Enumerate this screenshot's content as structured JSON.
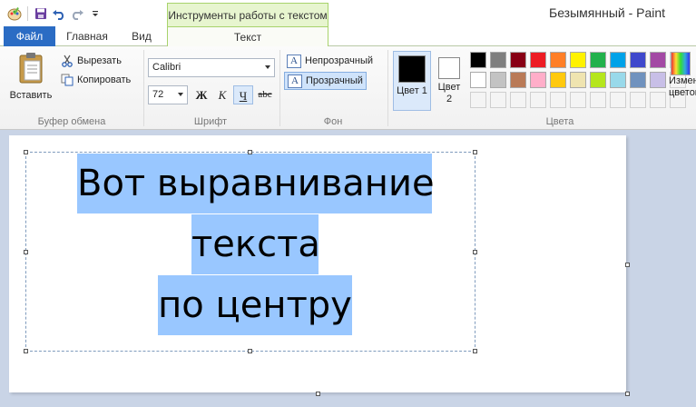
{
  "window": {
    "title": "Безымянный - Paint"
  },
  "quick_access": {
    "icons": [
      "paint-app-icon",
      "save-icon",
      "undo-icon",
      "redo-icon",
      "customize-icon"
    ]
  },
  "context_group": {
    "label": "Инструменты работы с текстом"
  },
  "tabs": {
    "file": "Файл",
    "home": "Главная",
    "view": "Вид",
    "text": "Текст"
  },
  "clipboard": {
    "paste": "Вставить",
    "cut": "Вырезать",
    "copy": "Копировать",
    "group_label": "Буфер обмена"
  },
  "font": {
    "family": "Calibri",
    "size": "72",
    "bold": "Ж",
    "italic": "К",
    "underline": "Ч",
    "strike": "abc",
    "group_label": "Шрифт"
  },
  "background": {
    "opaque": "Непрозрачный",
    "transparent": "Прозрачный",
    "group_label": "Фон",
    "selected": "transparent"
  },
  "colors": {
    "color1_label": "Цвет 1",
    "color2_label": "Цвет 2",
    "group_label": "Цвета",
    "edit_label": "Изменение цветов",
    "color1": "#000000",
    "color2": "#ffffff",
    "palette_row1": [
      "#000000",
      "#7f7f7f",
      "#880015",
      "#ed1c24",
      "#ff7f27",
      "#fff200",
      "#22b14c",
      "#00a2e8",
      "#3f48cc",
      "#a349a4"
    ],
    "palette_row2": [
      "#ffffff",
      "#c3c3c3",
      "#b97a57",
      "#ffaec9",
      "#ffc90e",
      "#efe4b0",
      "#b5e61d",
      "#99d9ea",
      "#7092be",
      "#c8bfe7"
    ]
  },
  "canvas": {
    "text_lines": [
      "Вот выравнивание",
      "текста",
      "по центру"
    ],
    "highlight_color": "#99c7ff"
  }
}
